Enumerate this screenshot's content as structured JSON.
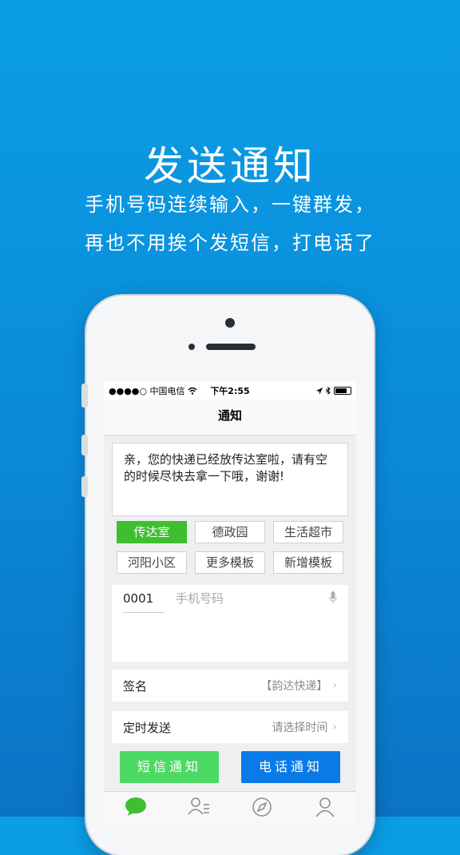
{
  "hero": {
    "title": "发送通知",
    "subtitle_line1": "手机号码连续输入，一键群发，",
    "subtitle_line2": "再也不用挨个发短信，打电话了"
  },
  "status_bar": {
    "carrier": "●●●●○ 中国电信",
    "time": "下午2:55"
  },
  "nav": {
    "title": "通知"
  },
  "message": {
    "text": "亲，您的快递已经放传达室啦，请有空的时候尽快去拿一下哦，谢谢!"
  },
  "templates": [
    {
      "label": "传达室",
      "active": true
    },
    {
      "label": "德政园",
      "active": false
    },
    {
      "label": "生活超市",
      "active": false
    },
    {
      "label": "河阳小区",
      "active": false
    },
    {
      "label": "更多模板",
      "active": false
    },
    {
      "label": "新增模板",
      "active": false
    }
  ],
  "phone_entry": {
    "code": "0001",
    "placeholder": "手机号码"
  },
  "signature": {
    "label": "签名",
    "value": "【韵达快递】"
  },
  "schedule": {
    "label": "定时发送",
    "value": "请选择时间"
  },
  "actions": {
    "sms": "短信通知",
    "call": "电话通知"
  },
  "tabs": [
    {
      "icon": "chat-bubble-icon",
      "active": true
    },
    {
      "icon": "contacts-icon",
      "active": false
    },
    {
      "icon": "compass-icon",
      "active": false
    },
    {
      "icon": "user-icon",
      "active": false
    }
  ],
  "colors": {
    "accent_green": "#3fbf2f",
    "sms_green": "#4cd964",
    "call_blue": "#0a7be6",
    "background_blue": "#0a8ad8"
  }
}
